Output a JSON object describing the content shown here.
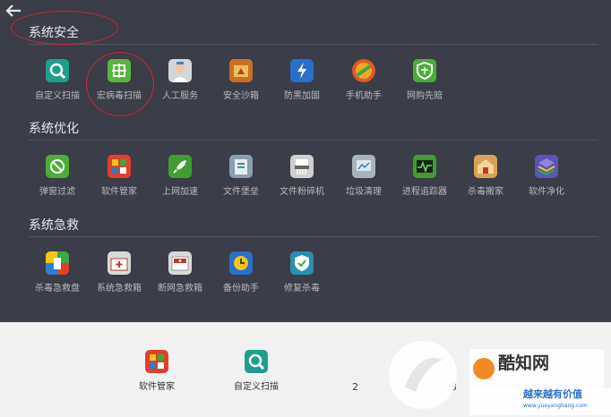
{
  "back_icon": "arrow-left-icon",
  "sections": [
    {
      "title": "系统安全",
      "items": [
        {
          "label": "自定义扫描",
          "icon": "magnifier-icon",
          "color": "#1f9e8e"
        },
        {
          "label": "宏病毒扫描",
          "icon": "macro-virus-scan-icon",
          "color": "#5ab43d"
        },
        {
          "label": "人工服务",
          "icon": "support-person-icon",
          "color": "#d6d6d6"
        },
        {
          "label": "安全沙箱",
          "icon": "sandbox-icon",
          "color": "#c8702a"
        },
        {
          "label": "防黑加固",
          "icon": "shield-lightning-icon",
          "color": "#2a6fc9"
        },
        {
          "label": "手机助手",
          "icon": "phone-assistant-icon",
          "color": "#e2572a"
        },
        {
          "label": "网购先赔",
          "icon": "shopping-shield-icon",
          "color": "#4aad38"
        }
      ]
    },
    {
      "title": "系统优化",
      "items": [
        {
          "label": "弹窗过滤",
          "icon": "popup-filter-icon",
          "color": "#4aad38"
        },
        {
          "label": "软件管家",
          "icon": "software-manager-icon",
          "color": "#e0402a"
        },
        {
          "label": "上网加速",
          "icon": "rocket-icon",
          "color": "#3e9f2f"
        },
        {
          "label": "文件堡垒",
          "icon": "file-vault-icon",
          "color": "#8aa0b0"
        },
        {
          "label": "文件粉碎机",
          "icon": "file-shredder-icon",
          "color": "#cfcfcf"
        },
        {
          "label": "垃圾清理",
          "icon": "junk-clean-icon",
          "color": "#a8b4bd"
        },
        {
          "label": "进程追踪器",
          "icon": "process-tracker-icon",
          "color": "#3e9f2f"
        },
        {
          "label": "杀毒搬家",
          "icon": "antivirus-move-icon",
          "color": "#d7a256"
        },
        {
          "label": "软件净化",
          "icon": "software-purify-icon",
          "color": "#5b55b8"
        }
      ]
    },
    {
      "title": "系统急救",
      "items": [
        {
          "label": "杀毒急救盘",
          "icon": "rescue-disk-icon",
          "color": "#e0402a"
        },
        {
          "label": "系统急救箱",
          "icon": "system-first-aid-icon",
          "color": "#d9d9d9"
        },
        {
          "label": "断网急救箱",
          "icon": "network-first-aid-icon",
          "color": "#d9d9d9"
        },
        {
          "label": "备份助手",
          "icon": "backup-clock-icon",
          "color": "#2a6fc9"
        },
        {
          "label": "修复杀毒",
          "icon": "repair-shield-icon",
          "color": "#2a8fb0"
        }
      ]
    }
  ],
  "bottom_bar": {
    "items": [
      {
        "label": "软件管家",
        "icon": "software-manager-icon",
        "color": "#e0402a"
      },
      {
        "label": "自定义扫描",
        "icon": "magnifier-icon",
        "color": "#1f9e8e"
      }
    ],
    "page_numbers": [
      "2",
      "3"
    ]
  },
  "watermark": {
    "brand_top": "酷知网",
    "brand_bottom": "越来越有价值",
    "url": "www.yueyangbang.com"
  }
}
